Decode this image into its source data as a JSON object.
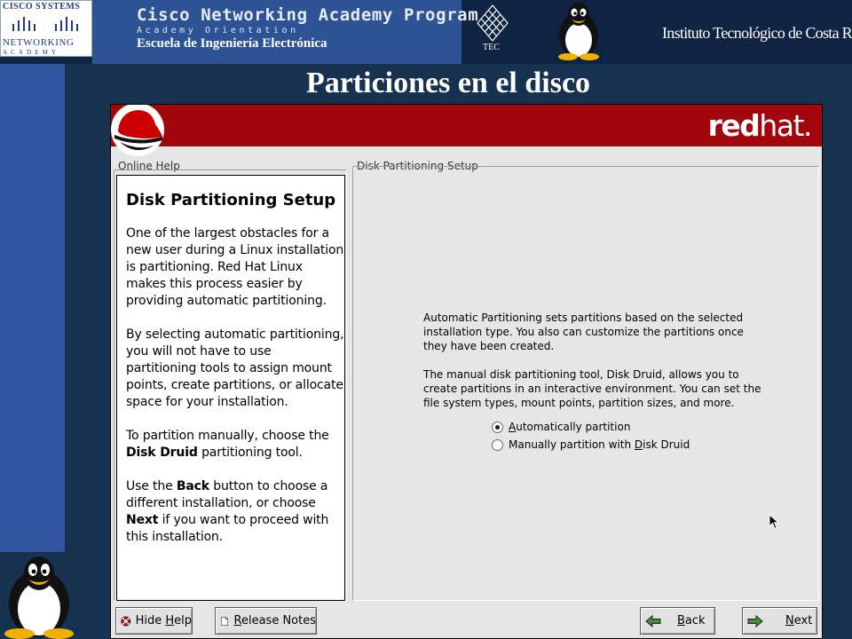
{
  "slide": {
    "cisco_logo": {
      "line1": "CISCO SYSTEMS",
      "line2": "NETWORKING",
      "line3": "ACADEMY"
    },
    "program_title": "Cisco Networking Academy Program",
    "program_subtitle": "Academy Orientation",
    "school": "Escuela de Ingeniería Electrónica",
    "tec_label": "TEC",
    "institute": "Instituto Tecnológico de Costa Rica",
    "title": "Particiones en el disco"
  },
  "installer": {
    "brand": {
      "bold": "red",
      "thin": "hat."
    },
    "help_legend": "Online Help",
    "setup_legend": "Disk Partitioning Setup",
    "help": {
      "title": "Disk Partitioning Setup",
      "p1": "One of the largest obstacles for a new user during a Linux installation is partitioning. Red Hat Linux makes this process easier by providing automatic partitioning.",
      "p2": "By selecting automatic partitioning, you will not have to use partitioning tools to assign mount points, create partitions, or allocate space for your installation.",
      "p3_pre": "To partition manually, choose the ",
      "p3_bold": "Disk Druid",
      "p3_post": " partitioning tool.",
      "p4_pre": "Use the ",
      "p4_bold1": "Back",
      "p4_mid": " button to choose a different installation, or choose ",
      "p4_bold2": "Next",
      "p4_post": " if you want to proceed with this installation."
    },
    "setup": {
      "para1": "Automatic Partitioning sets partitions based on the selected installation type. You also can customize the partitions once they have been created.",
      "para2": "The manual disk partitioning tool, Disk Druid, allows you to create partitions in an interactive environment. You can set the file system types, mount points, partition sizes, and more.",
      "options": [
        {
          "mnemonic": "A",
          "rest": "utomatically partition",
          "selected": true
        },
        {
          "pre": "Manually partition with ",
          "mnemonic": "D",
          "rest": "isk Druid",
          "selected": false
        }
      ]
    },
    "buttons": {
      "hide_help": {
        "pre": "Hide ",
        "mnemonic": "H",
        "rest": "elp",
        "icon": "lifebuoy-icon"
      },
      "release_notes": {
        "mnemonic": "R",
        "rest": "elease Notes",
        "icon": "document-icon"
      },
      "back": {
        "mnemonic": "B",
        "rest": "ack",
        "icon": "arrow-left-icon"
      },
      "next": {
        "mnemonic": "N",
        "rest": "ext",
        "icon": "arrow-right-icon"
      }
    }
  },
  "colors": {
    "redhat_red": "#a0060c",
    "slide_navy": "#173150",
    "slide_blue": "#3155a0"
  }
}
